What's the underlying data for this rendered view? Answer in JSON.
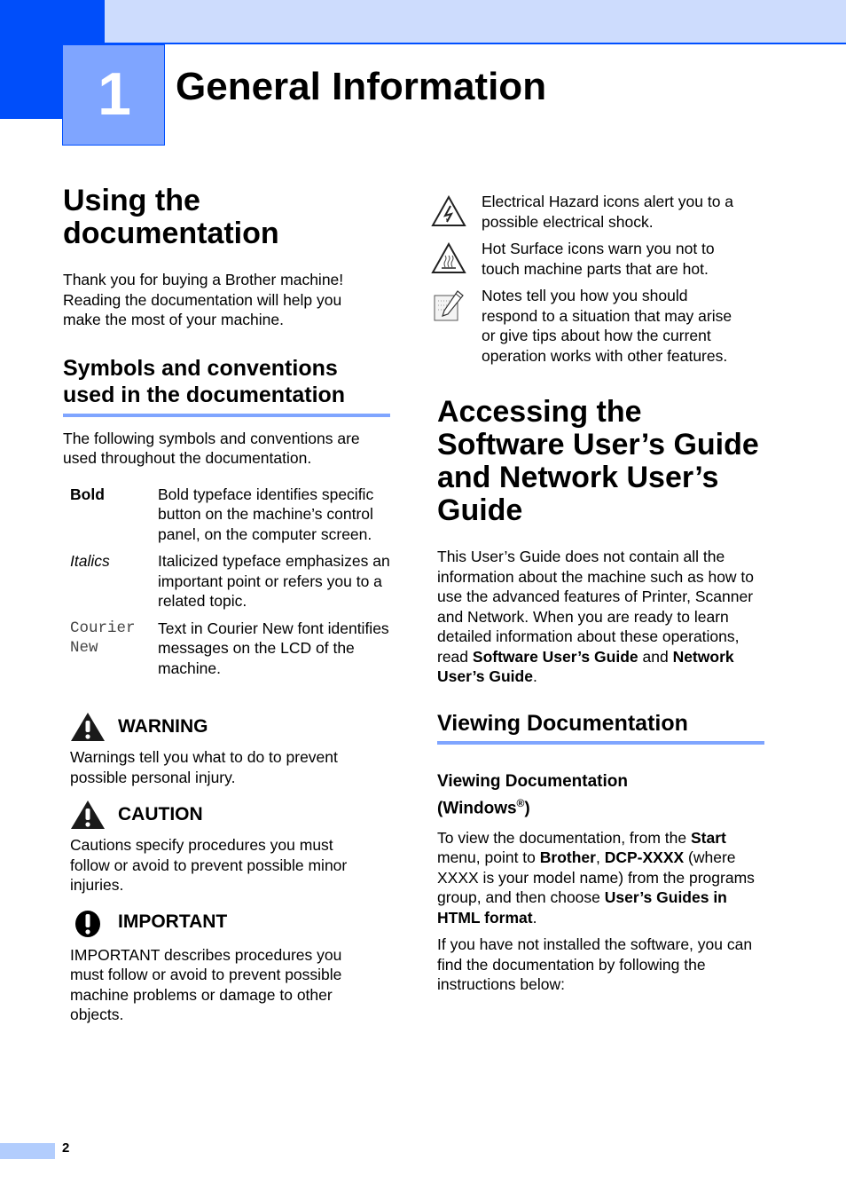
{
  "chapter": {
    "number": "1",
    "title": "General Information"
  },
  "using": {
    "heading": "Using the documentation",
    "intro": "Thank you for buying a Brother machine! Reading the documentation will help you make the most of your machine."
  },
  "symbols": {
    "heading": "Symbols and conventions used in the documentation",
    "intro": "The following symbols and conventions are used throughout the documentation.",
    "conventions": [
      {
        "term": "Bold",
        "style": "bold",
        "desc": "Bold typeface identifies specific button on the machine’s control panel, on the computer screen."
      },
      {
        "term": "Italics",
        "style": "italic",
        "desc": "Italicized typeface emphasizes an important point or refers you to a related topic."
      },
      {
        "term": "Courier New",
        "style": "mono",
        "desc": "Text in Courier New font identifies messages on the LCD of the machine."
      }
    ],
    "notices": [
      {
        "icon": "warning-triangle-icon",
        "title": "WARNING",
        "text": "Warnings tell you what to do to prevent possible personal injury."
      },
      {
        "icon": "caution-triangle-icon",
        "title": "CAUTION",
        "text": "Cautions specify procedures you must follow or avoid to prevent possible minor injuries."
      },
      {
        "icon": "important-exclamation-icon",
        "title": "IMPORTANT",
        "text": "IMPORTANT describes procedures you must follow or avoid to prevent possible machine problems or damage to other objects."
      }
    ],
    "icon_descriptions": [
      {
        "icon": "electrical-hazard-icon",
        "text": "Electrical Hazard icons alert you to a possible electrical shock."
      },
      {
        "icon": "hot-surface-icon",
        "text": "Hot Surface icons warn you not to touch machine parts that are hot."
      },
      {
        "icon": "note-pencil-icon",
        "text": "Notes tell you how you should respond to a situation that may arise or give tips about how the current operation works with other features."
      }
    ]
  },
  "accessing": {
    "heading": "Accessing the Software User’s Guide and Network User’s Guide",
    "body_pre": "This User’s Guide does not contain all the information about the machine such as how to use the advanced features of Printer, Scanner and Network. When you are ready to learn detailed information about these operations, read ",
    "bold1": "Software User’s Guide",
    "body_mid": " and ",
    "bold2": "Network User’s Guide",
    "body_post": "."
  },
  "viewing": {
    "heading": "Viewing Documentation",
    "windows_heading": "Viewing Documentation (Windows",
    "windows_reg": "®",
    "windows_close": ")",
    "p1": {
      "t1": "To view the documentation, from the ",
      "b1": "Start",
      "t2": " menu, point to ",
      "b2": "Brother",
      "t3": ", ",
      "b3": "DCP-XXXX",
      "t4": " (where XXXX is your model name) from the programs group, and then choose ",
      "b4": "User’s Guides in HTML format",
      "t5": "."
    },
    "p2": "If you have not installed the software, you can find the documentation by following the instructions below:"
  },
  "footer": {
    "page_number": "2"
  }
}
